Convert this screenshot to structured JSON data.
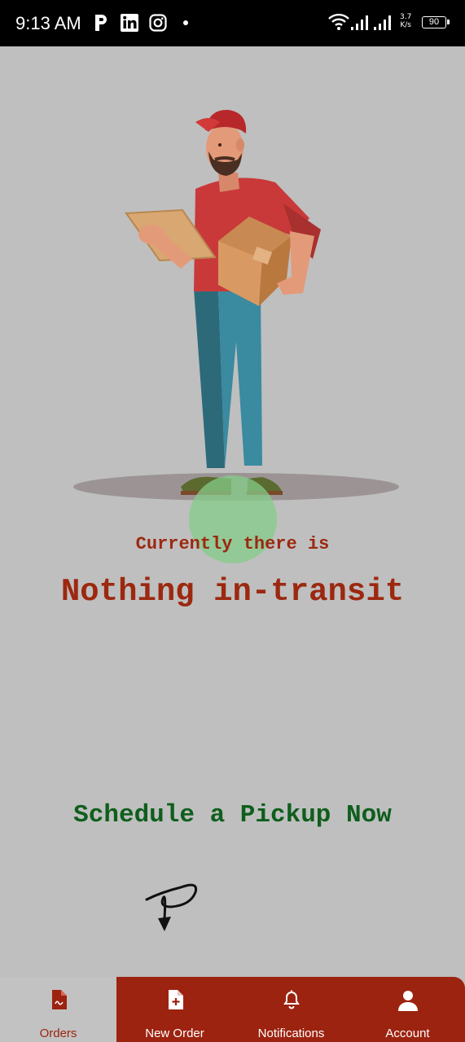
{
  "status_bar": {
    "time": "9:13 AM",
    "network_speed_value": "3.7",
    "network_speed_unit": "K/s",
    "battery": "90",
    "icons": [
      "parking-p-icon",
      "linkedin-icon",
      "instagram-icon",
      "dot-icon",
      "wifi-icon",
      "signal-icon",
      "signal-icon",
      "battery-icon"
    ]
  },
  "empty_state": {
    "line1": "Currently there is",
    "line2": "Nothing in-transit"
  },
  "cta": {
    "label": "Schedule a Pickup Now"
  },
  "bottom_nav": {
    "items": [
      {
        "label": "Orders",
        "icon": "document-icon",
        "active": true
      },
      {
        "label": "New Order",
        "icon": "add-document-icon",
        "active": false
      },
      {
        "label": "Notifications",
        "icon": "bell-icon",
        "active": false
      },
      {
        "label": "Account",
        "icon": "person-icon",
        "active": false
      }
    ]
  },
  "colors": {
    "background": "#bfbfbf",
    "accent": "#9c2310",
    "cta_green": "#0f5e1c",
    "status_bar": "#000000"
  }
}
